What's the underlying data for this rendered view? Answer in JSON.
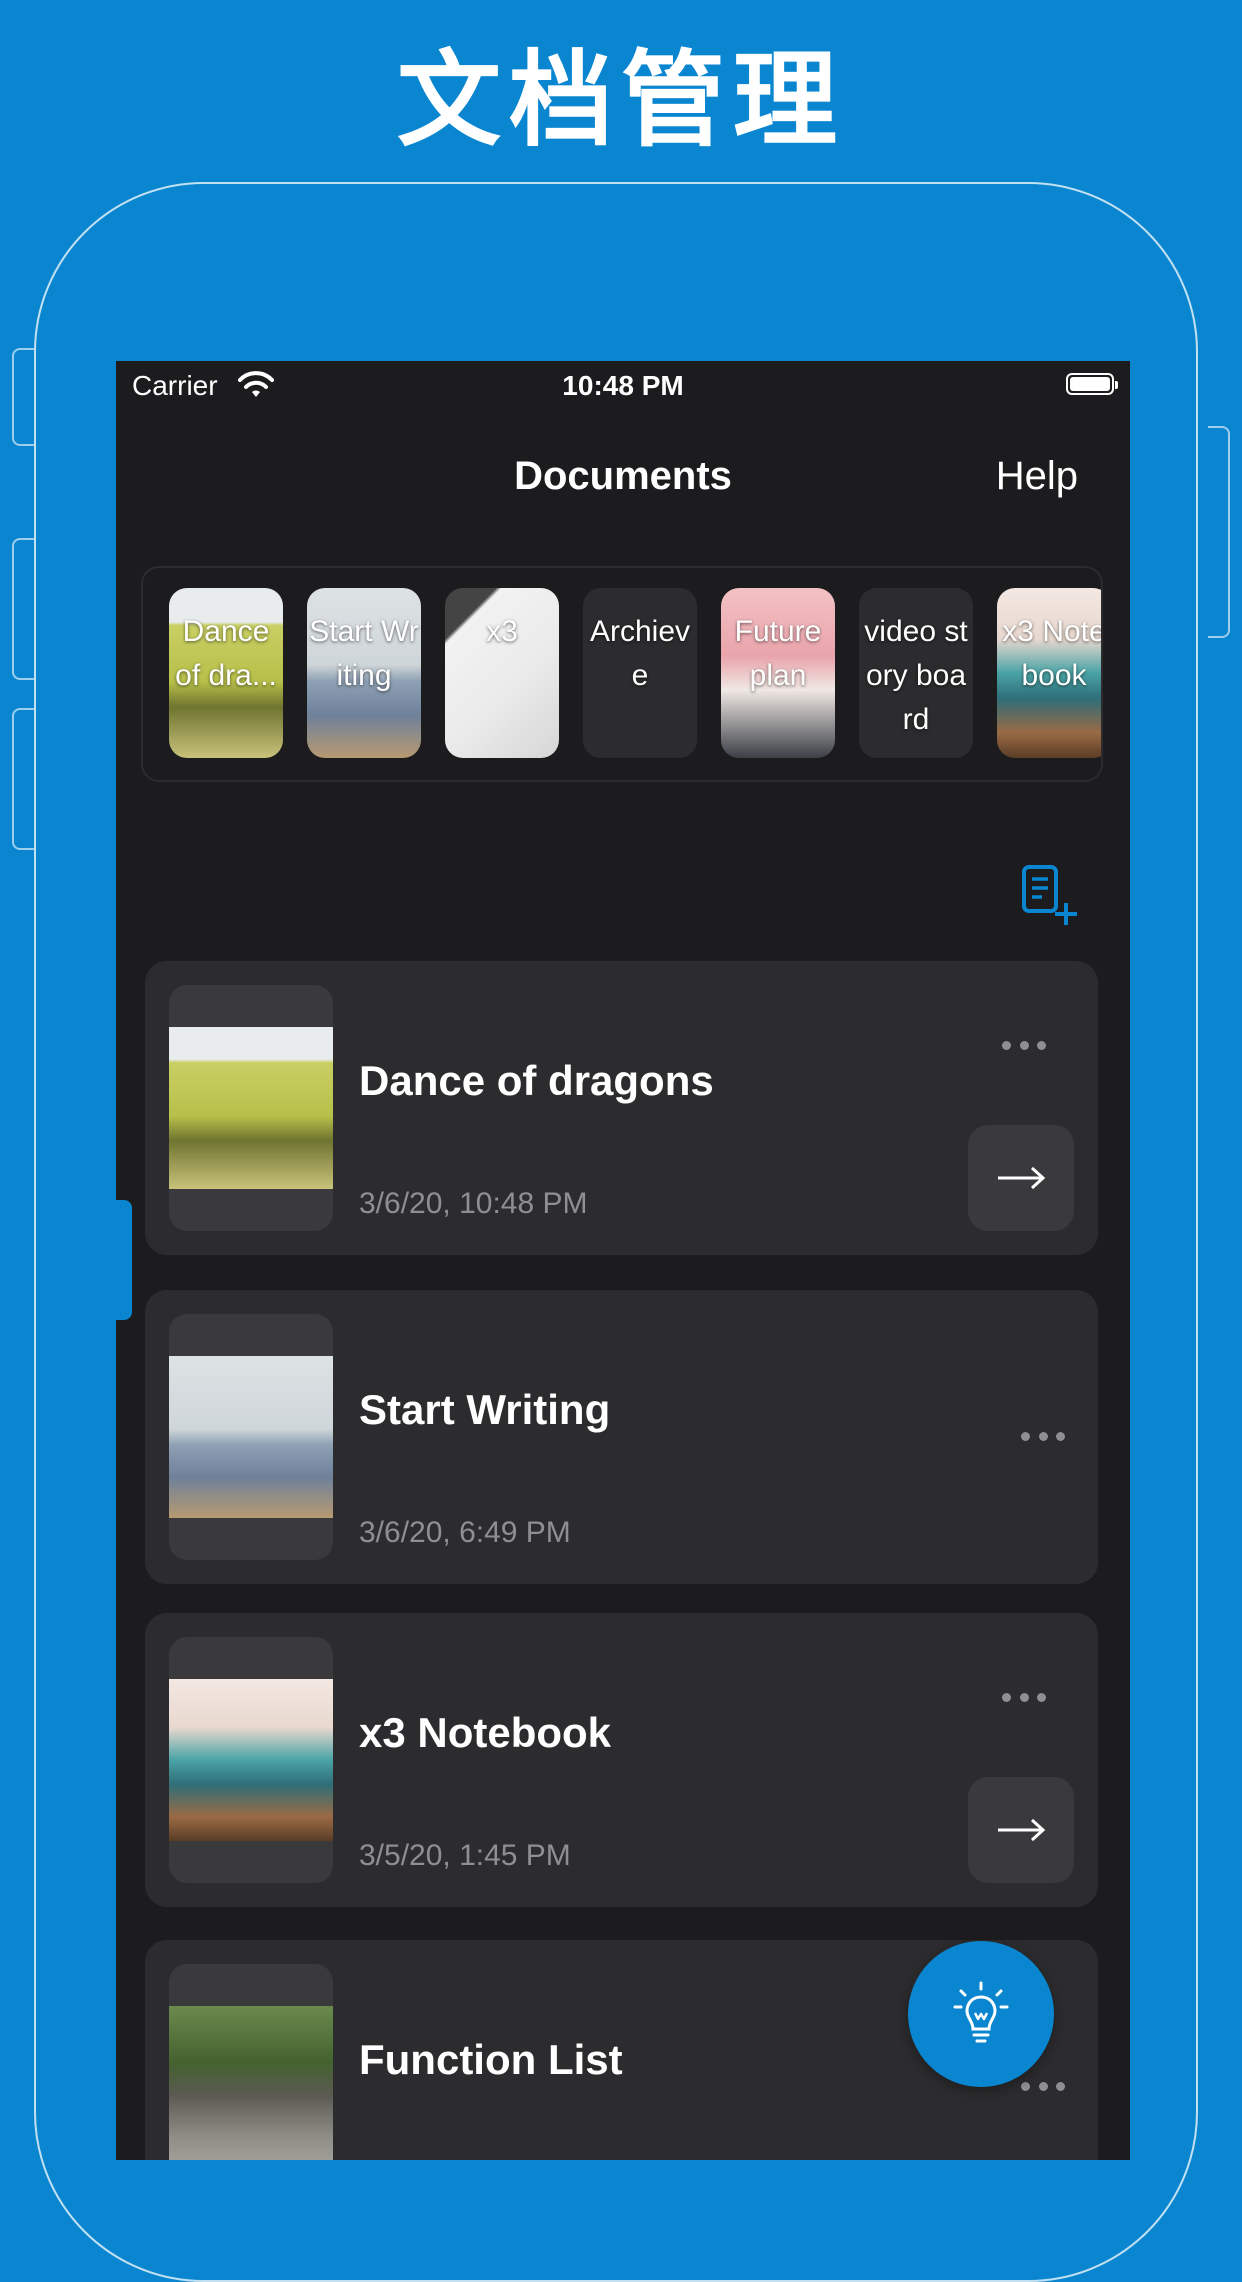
{
  "promo": {
    "title": "文档管理"
  },
  "status_bar": {
    "carrier": "Carrier",
    "time": "10:48 PM"
  },
  "nav": {
    "title": "Documents",
    "help_label": "Help"
  },
  "quick_access": [
    {
      "label": "Dance of dra...",
      "thumb": "car"
    },
    {
      "label": "Start Writing",
      "thumb": "dog"
    },
    {
      "label": "x3",
      "thumb": "notebook"
    },
    {
      "label": "Archieve",
      "thumb": "archive"
    },
    {
      "label": "Future plan",
      "thumb": "woman"
    },
    {
      "label": "video story board",
      "thumb": "dark"
    },
    {
      "label": "x3 Note book",
      "thumb": "grass"
    }
  ],
  "documents": [
    {
      "title": "Dance of dragons",
      "date": "3/6/20, 10:48 PM",
      "thumb": "car",
      "stacked": true
    },
    {
      "title": "Start Writing",
      "date": "3/6/20, 6:49 PM",
      "thumb": "dog",
      "stacked": false
    },
    {
      "title": "x3 Notebook",
      "date": "3/5/20, 1:45 PM",
      "thumb": "grass",
      "stacked": true
    },
    {
      "title": "Function List",
      "date": "",
      "thumb": "moto",
      "stacked": false
    }
  ],
  "icons": {
    "new_document": "new-document-icon",
    "more": "more-horizontal-icon",
    "open": "arrow-right-icon",
    "fab": "lightbulb-icon"
  },
  "colors": {
    "background": "#0a86d0",
    "screen": "#1c1c1e",
    "card": "#2c2c2e",
    "accent": "#0a86d0"
  }
}
